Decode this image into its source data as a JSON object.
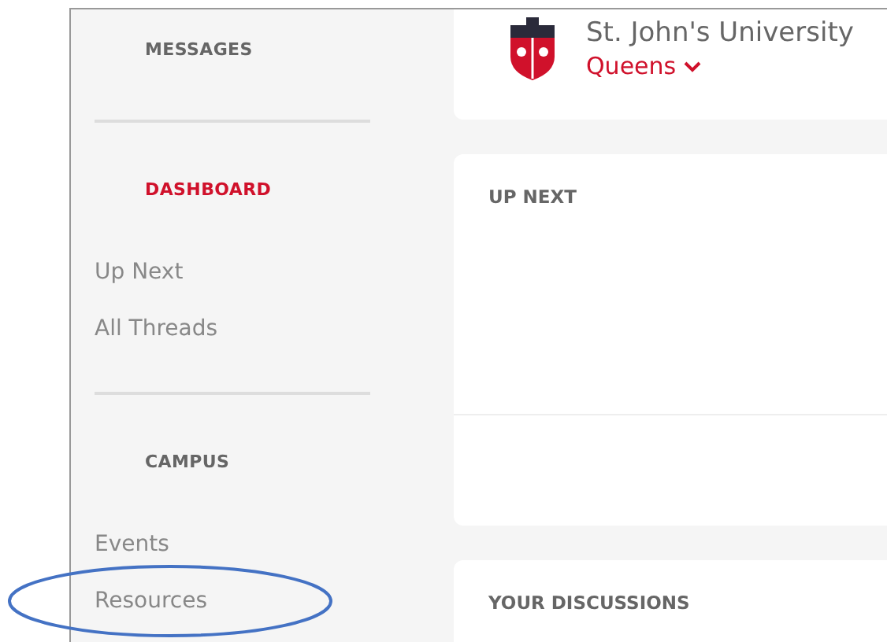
{
  "sidebar": {
    "sections": [
      {
        "heading": "MESSAGES",
        "selected": false
      },
      {
        "heading": "DASHBOARD",
        "selected": true,
        "items": [
          "Up Next",
          "All Threads"
        ]
      },
      {
        "heading": "CAMPUS",
        "selected": false,
        "items": [
          "Events",
          "Resources"
        ]
      }
    ]
  },
  "header": {
    "school": "St. John's University",
    "campus": "Queens"
  },
  "cards": [
    {
      "title": "UP NEXT"
    },
    {
      "title": "YOUR DISCUSSIONS"
    }
  ]
}
